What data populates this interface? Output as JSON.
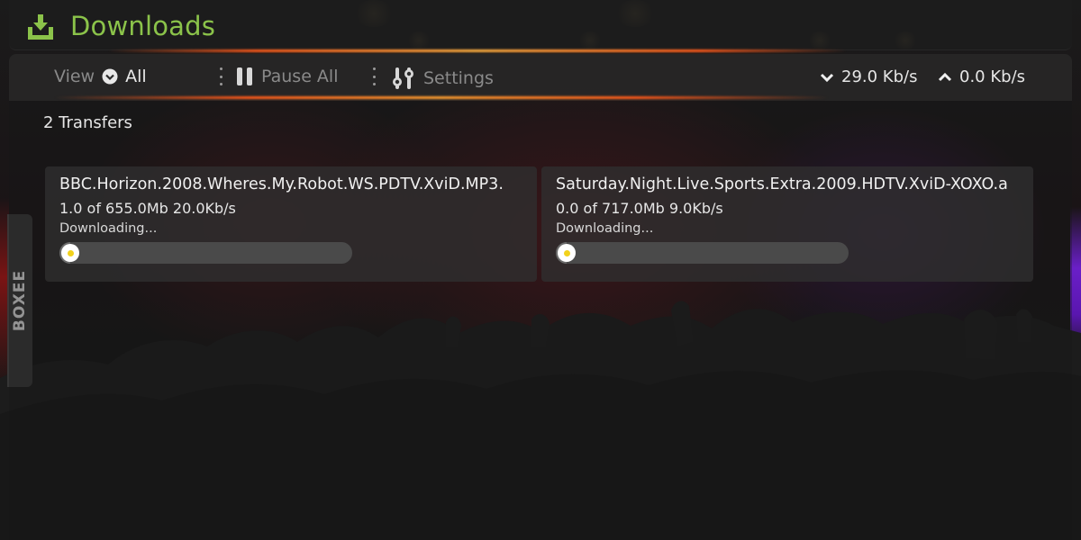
{
  "header": {
    "title": "Downloads",
    "icon": "download-tray-icon",
    "accent_color": "#8bc34a"
  },
  "toolbar": {
    "view_label": "View",
    "view_selected": "All",
    "pause_label": "Pause All",
    "settings_label": "Settings",
    "download_speed": "29.0 Kb/s",
    "upload_speed": "0.0 Kb/s"
  },
  "transfers": {
    "count_label": "2 Transfers",
    "items": [
      {
        "filename": "BBC.Horizon.2008.Wheres.My.Robot.WS.PDTV.XviD.MP3.",
        "progress_text": "1.0 of 655.0Mb 20.0Kb/s",
        "status": "Downloading...",
        "progress_fraction": 0.0015
      },
      {
        "filename": "Saturday.Night.Live.Sports.Extra.2009.HDTV.XviD-XOXO.a",
        "progress_text": "0.0 of 717.0Mb 9.0Kb/s",
        "status": "Downloading...",
        "progress_fraction": 0.0
      }
    ]
  },
  "side_tab": {
    "label": "BOXEE"
  }
}
